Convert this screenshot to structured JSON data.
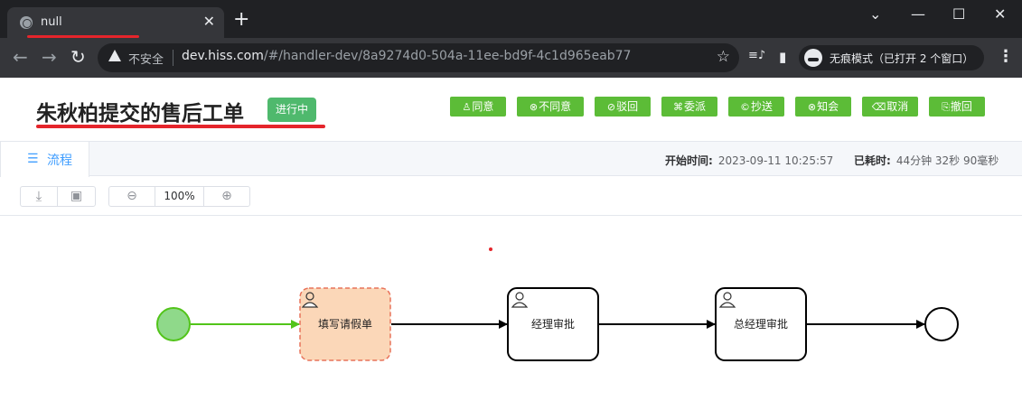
{
  "browser": {
    "tab_title": "null",
    "tab_close": "✕",
    "new_tab": "+",
    "window_controls": {
      "minimize": "—",
      "maximize": "☐",
      "close": "✕",
      "tab_search": "⌄"
    },
    "nav": {
      "back": "←",
      "forward": "→",
      "reload": "↻"
    },
    "security_label": "不安全",
    "url_host": "dev.hiss.com",
    "url_path": "/#/handler-dev/8a9274d0-504a-11ee-bd9f-4c1d965eab77",
    "incognito_label": "无痕模式（已打开 2 个窗口）",
    "icons": {
      "star": "☆",
      "media": "≡♪",
      "sidepanel": "▮",
      "menu": "⋮"
    }
  },
  "header": {
    "title": "朱秋柏提交的售后工单",
    "status": "进行中",
    "actions": [
      {
        "icon": "♙",
        "label": "同意"
      },
      {
        "icon": "⊗",
        "label": "不同意"
      },
      {
        "icon": "⊘",
        "label": "驳回"
      },
      {
        "icon": "⌘",
        "label": "委派"
      },
      {
        "icon": "©",
        "label": "抄送"
      },
      {
        "icon": "⊗",
        "label": "知会"
      },
      {
        "icon": "⌫",
        "label": "取消"
      },
      {
        "icon": "⎘",
        "label": "撤回"
      }
    ],
    "accent": "#5cbc37",
    "status_color": "#4fb96d"
  },
  "tabs": {
    "flow_icon": "☰",
    "flow_label": "流程"
  },
  "meta": {
    "start_label": "开始时间:",
    "start_value": "2023-09-11 10:25:57",
    "elapsed_label": "已耗时:",
    "elapsed_value": "44分钟 32秒 90毫秒"
  },
  "controls": {
    "download_icon": "⤓",
    "image_icon": "▣",
    "zoom_out_icon": "⊖",
    "zoom_level": "100%",
    "zoom_in_icon": "⊕"
  },
  "process": {
    "nodes": [
      {
        "name": "填写请假单",
        "state": "active"
      },
      {
        "name": "经理审批",
        "state": "pending"
      },
      {
        "name": "总经理审批",
        "state": "pending"
      }
    ],
    "start_state": "completed",
    "end_state": "pending",
    "colors": {
      "completed": "#52c41a",
      "active_fill": "#fbd7b8",
      "active_border": "#e8735a",
      "pending": "#000000"
    }
  }
}
